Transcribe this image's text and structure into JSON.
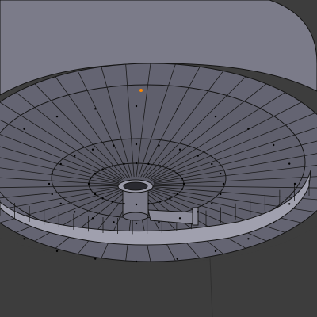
{
  "viewport": {
    "background": "#3d3d3d",
    "mesh_face_color": "#6a6a78",
    "mesh_face_light": "#8b8b99",
    "mesh_face_dark": "#4e4e58",
    "wire_color": "#151515",
    "vertex_color": "#000000",
    "selected_vertex_color": "#ff8800"
  },
  "icons": [
    "3d-mesh-icon"
  ]
}
